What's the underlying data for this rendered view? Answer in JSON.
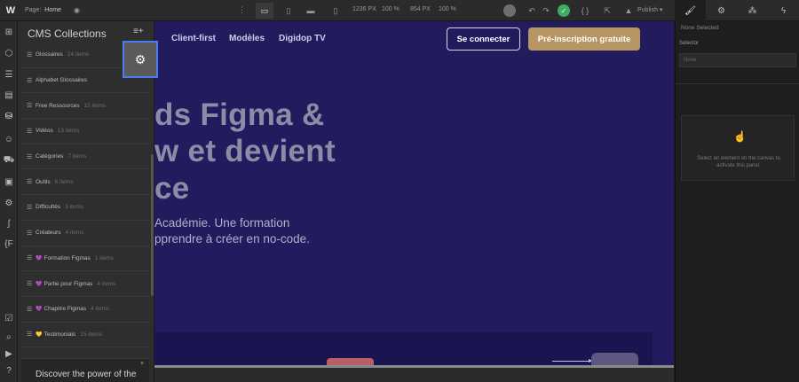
{
  "topbar": {
    "logo": "W",
    "page_label": "Page:",
    "page_name": "Home",
    "width_value": "1236",
    "width_unit": "PX",
    "zoom_1": "100 %",
    "height_value": "854",
    "height_unit": "PX",
    "zoom_2": "100 %",
    "publish_label": "Publish ▾",
    "icons": [
      "eye-icon",
      "more-dots-icon",
      "desktop-icon",
      "tablet-icon",
      "tablet-landscape-icon",
      "phone-icon",
      "avatar-icon",
      "undo-icon",
      "redo-icon",
      "saved-check-icon",
      "code-icon",
      "export-icon",
      "designer-icon",
      "style-brush-icon",
      "settings-gear-icon",
      "interactions-icon",
      "lightning-icon"
    ]
  },
  "leftbar": {
    "icons": [
      "add-panel-icon",
      "components-icon",
      "navigator-icon",
      "pages-icon",
      "cms-icon",
      "users-icon",
      "ecommerce-icon",
      "assets-icon",
      "settings-icon",
      "logic-icon",
      "apps-icon",
      "audit-icon",
      "search-icon",
      "video-icon",
      "help-icon"
    ]
  },
  "cms": {
    "title": "CMS Collections",
    "items": [
      {
        "name": "Glossaires",
        "count": "24 items",
        "prefix": ""
      },
      {
        "name": "Alphabet Glossaires",
        "count": "",
        "prefix": ""
      },
      {
        "name": "Free Ressources",
        "count": "15 items",
        "prefix": ""
      },
      {
        "name": "Vidéos",
        "count": "13 items",
        "prefix": ""
      },
      {
        "name": "Catégories",
        "count": "7 items",
        "prefix": ""
      },
      {
        "name": "Outils",
        "count": "6 items",
        "prefix": ""
      },
      {
        "name": "Difficultés",
        "count": "3 items",
        "prefix": ""
      },
      {
        "name": "Créateurs",
        "count": "4 items",
        "prefix": ""
      },
      {
        "name": "Formation Figmas",
        "count": "1 items",
        "prefix": "💜"
      },
      {
        "name": "Partie pour Figmas",
        "count": "4 items",
        "prefix": "💜"
      },
      {
        "name": "Chapitre Figmas",
        "count": "4 items",
        "prefix": "💜"
      },
      {
        "name": "Testimonials",
        "count": "15 items",
        "prefix": "💛"
      }
    ],
    "promo_text": "Discover the power of the",
    "promo_close": "×"
  },
  "canvas": {
    "nav": [
      "Client-first",
      "Modèles",
      "Digidop TV"
    ],
    "login": "Se connecter",
    "signup": "Pré-inscription gratuite",
    "hero_lines": [
      "ds Figma &",
      "w et devient",
      "ce"
    ],
    "sub_lines": [
      "Académie. Une formation",
      "pprendre à créer en no-code."
    ]
  },
  "right_panel": {
    "none_selected": "None Selected",
    "selector_label": "Selector",
    "selector_placeholder": "None",
    "empty_message": "Select an element on the canvas to activate this panel."
  },
  "colors": {
    "canvas_bg": "#221b5e",
    "signup_btn": "#b89664",
    "selection_outline": "#4c7df0",
    "saved_green": "#3dad63"
  }
}
